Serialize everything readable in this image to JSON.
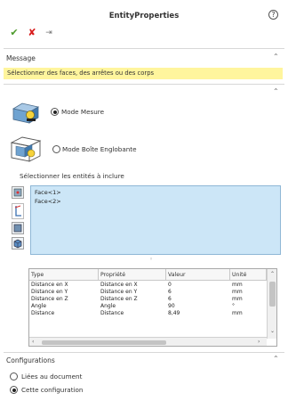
{
  "window": {
    "title": "EntityProperties",
    "help_glyph": "?"
  },
  "toolbar": {
    "ok_glyph": "✔",
    "cancel_glyph": "✘",
    "pin_glyph": "⇥"
  },
  "message_section": {
    "label": "Message",
    "text": "Sélectionner des faces, des arrêtes ou des corps"
  },
  "mode": {
    "options": [
      {
        "label": "Mode Mesure",
        "selected": true
      },
      {
        "label": "Mode Boîte Englobante",
        "selected": false
      }
    ]
  },
  "selection": {
    "label": "Sélectionner les entités à inclure",
    "items": [
      "Face<1>",
      "Face<2>"
    ]
  },
  "table": {
    "headers": [
      "Type",
      "Propriété",
      "Valeur",
      "Unité"
    ],
    "rows": [
      [
        "Distance en X",
        "Distance en X",
        "0",
        "mm"
      ],
      [
        "Distance en Y",
        "Distance en Y",
        "6",
        "mm"
      ],
      [
        "Distance en Z",
        "Distance en Z",
        "6",
        "mm"
      ],
      [
        "Angle",
        "Angle",
        "90",
        "°"
      ],
      [
        "Distance",
        "Distance",
        "8,49",
        "mm"
      ]
    ]
  },
  "configurations": {
    "label": "Configurations",
    "options": [
      {
        "label": "Liées au document",
        "selected": false
      },
      {
        "label": "Cette configuration",
        "selected": true
      }
    ]
  },
  "colors": {
    "message_bg": "#fff59d",
    "selection_bg": "#cce6f7",
    "ok": "#4c9a2a",
    "cancel": "#d81b1b"
  }
}
